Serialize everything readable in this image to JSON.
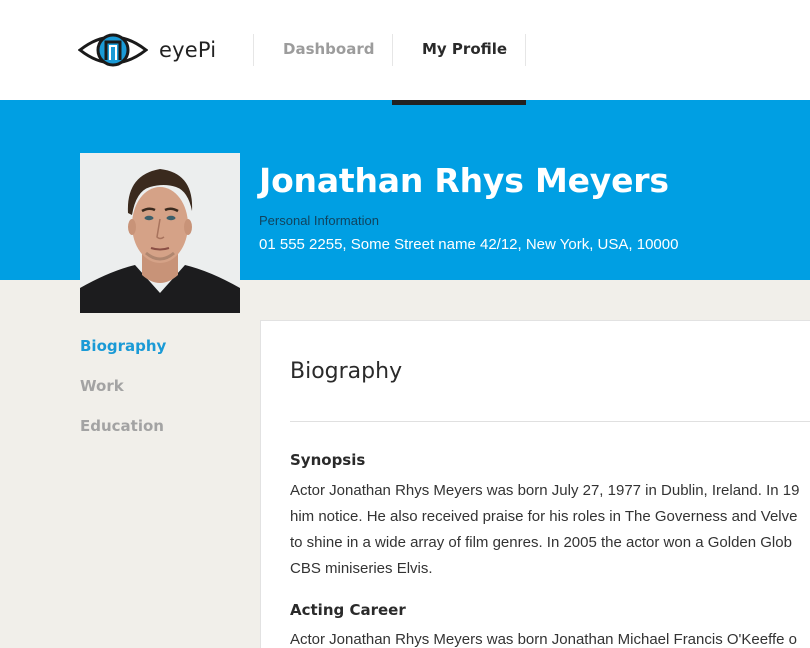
{
  "header": {
    "logo_text": "eyePi",
    "nav": [
      {
        "label": "Dashboard"
      },
      {
        "label": "My Profile"
      }
    ]
  },
  "profile": {
    "name": "Jonathan Rhys Meyers",
    "personal_info_label": "Personal Information",
    "personal_info_value": "01 555 2255, Some Street name 42/12, New York, USA, 10000"
  },
  "sidebar": {
    "items": [
      {
        "label": "Biography"
      },
      {
        "label": "Work"
      },
      {
        "label": "Education"
      }
    ]
  },
  "content": {
    "title": "Biography",
    "sections": [
      {
        "heading": "Synopsis",
        "lines": [
          "Actor Jonathan Rhys Meyers was born July 27, 1977 in Dublin, Ireland. In 19",
          "him notice. He also received praise for his roles in The Governess and Velve",
          "to shine in a wide array of film genres. In 2005 the actor won a Golden Glob",
          "CBS miniseries Elvis."
        ]
      },
      {
        "heading": "Acting Career",
        "lines": [
          "Actor Jonathan Rhys Meyers was born Jonathan Michael Francis O'Keeffe o"
        ]
      }
    ]
  },
  "colors": {
    "brand_blue": "#009fe3",
    "active_link": "#1a9ad6",
    "page_bg": "#f1efea"
  }
}
